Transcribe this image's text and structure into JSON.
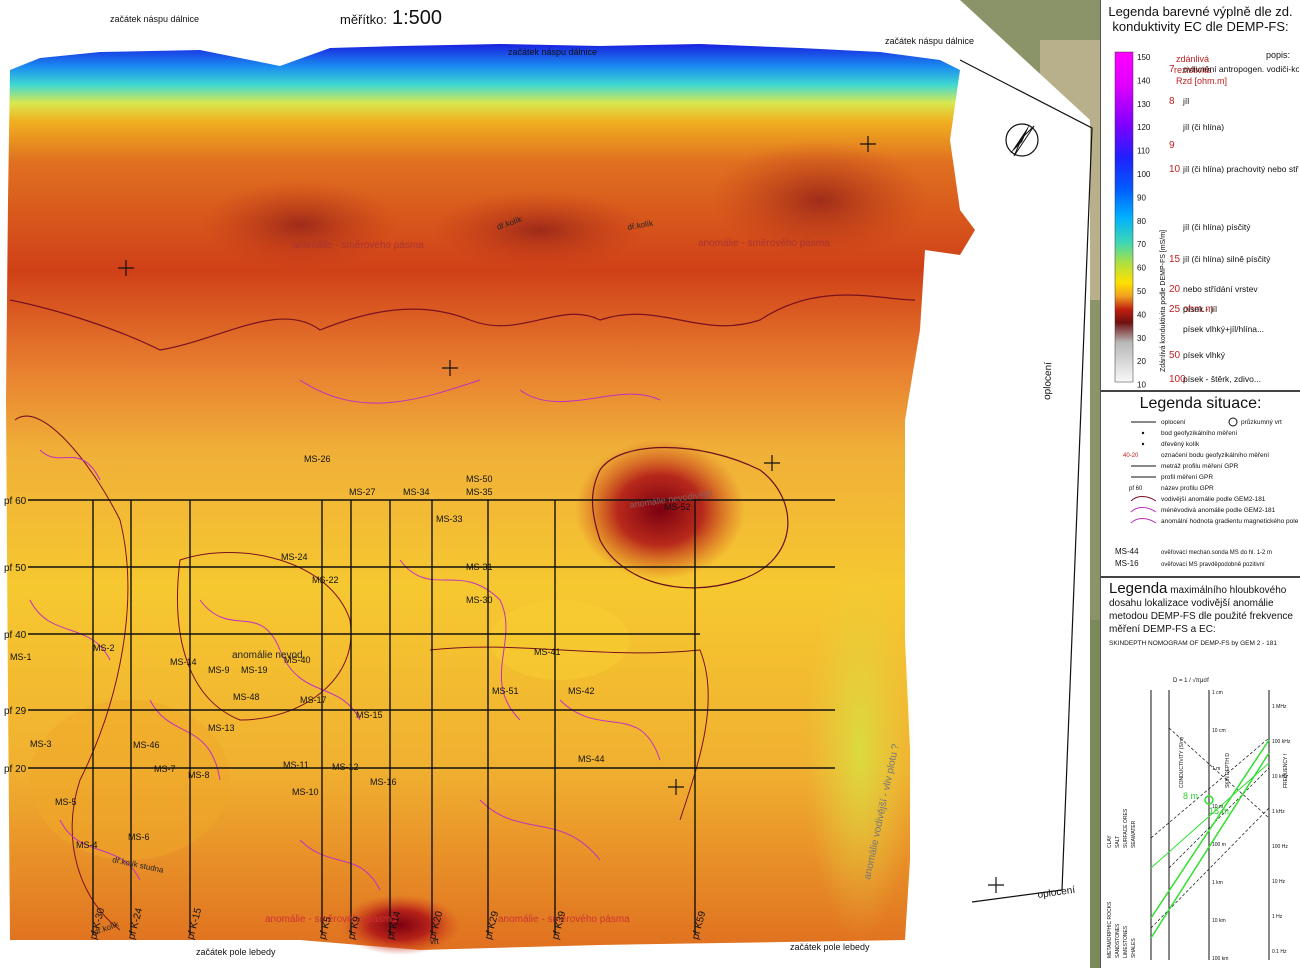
{
  "map": {
    "scale_label": "měřítko:",
    "scale_value": "1:500",
    "top_labels": [
      "začátek náspu dálnice",
      "začátek náspu dálnice",
      "začátek náspu dálnice"
    ],
    "bottom_labels": [
      "začátek pole lebedy",
      "začátek pole lebedy"
    ],
    "fence_labels": [
      "oplocení",
      "oplocení"
    ],
    "anomaly_labels": [
      "anomálie - směrového pásma",
      "anomálie - směrového pásma",
      "anomálie - směrového pásma",
      "anomálie - směrového pásma"
    ],
    "anomaly_center_label": "anomálie nevodivější",
    "anomaly_left_label": "anomálie\nnevod.",
    "side_anomaly_label": "anomálie vodivější - vliv plotu ?",
    "stake_labels": [
      "dř.kolík",
      "dř.kolík",
      "dř.kolík",
      "dř.kolík studna"
    ],
    "drill_label": "vrt",
    "profile_rows": [
      "pf 60",
      "pf 50",
      "pf 40",
      "pf 29",
      "pf 20"
    ],
    "profile_cols": [
      "pf K-30",
      "pf K-24",
      "pf K-15",
      "pf K5",
      "pf K9",
      "pf K14",
      "pf K20",
      "pf K29",
      "pf K39",
      "pf K59"
    ],
    "ms_points": [
      "MS-26",
      "MS-27",
      "MS-34",
      "MS-50",
      "MS-35",
      "MS-33",
      "MS-24",
      "MS-22",
      "MS-31",
      "MS-30",
      "MS-1",
      "MS-2",
      "MS-14",
      "MS-9",
      "MS-19",
      "MS-40",
      "MS-48",
      "MS-17",
      "MS-41",
      "MS-51",
      "MS-42",
      "MS-13",
      "MS-15",
      "MS-3",
      "MS-46",
      "MS-7",
      "MS-8",
      "MS-11",
      "MS-10",
      "MS-12",
      "MS-16",
      "MS-44",
      "MS-5",
      "MS-6",
      "MS-4",
      "MS-52"
    ]
  },
  "legend_ec": {
    "title": "Legenda barevné výplně dle zd. konduktivity EC dle DEMP-FS:",
    "axis_label": "Zdánlivá konduktivita podle DEMP-FS [mS/m]",
    "ticks": [
      "150",
      "140",
      "130",
      "120",
      "110",
      "100",
      "90",
      "80",
      "70",
      "60",
      "50",
      "40",
      "30",
      "20",
      "10"
    ],
    "resistivity_header": "zdánlivá rezistivita Rzd [ohm.m]",
    "notes_header": "popis:",
    "rows": [
      {
        "r": "7",
        "d": "ovlivnění antropogen. vodiči-kovy"
      },
      {
        "r": "8",
        "d": "jíl"
      },
      {
        "r": "",
        "d": "jíl (či hlína)"
      },
      {
        "r": "9",
        "d": ""
      },
      {
        "r": "10",
        "d": "jíl (či hlína) prachovitý nebo střídání vrstev"
      },
      {
        "r": "",
        "d": "jíl (či hlína) písčitý"
      },
      {
        "r": "15",
        "d": "jíl (či hlína) silně písčitý"
      },
      {
        "r": "20",
        "d": "nebo střídání vrstev"
      },
      {
        "r": "25 ohm.m",
        "d": "písek - jíl"
      },
      {
        "r": "",
        "d": "písek vlhký+jíl/hlína..."
      },
      {
        "r": "50",
        "d": "písek vlhký"
      },
      {
        "r": "100",
        "d": "písek - štěrk, zdivo..."
      }
    ],
    "colors": [
      "#ff00ff",
      "#c000ff",
      "#8000ff",
      "#0000ff",
      "#0080ff",
      "#00c0ff",
      "#00e0a0",
      "#a0e000",
      "#ffe000",
      "#ffa000",
      "#e05000",
      "#a01000",
      "#b0b0b0",
      "#d8d8d8",
      "#f4f4f4"
    ]
  },
  "legend_sit": {
    "title": "Legenda situace:",
    "items": [
      "oplocení",
      "průzkumný vrt",
      "bod geofyzikálního měření",
      "dřevěný kolík",
      "40-20",
      "označení bodu geofyzikálního měření",
      "metráž profilu měření GPR",
      "profil měření GPR",
      "pf 60",
      "název profilu GPR",
      "vodivější anomálie podle GEM2-181",
      "méněvodivá anomálie podle GEM2-181",
      "anomální hodnota gradientu magnetického pole",
      "MS-44",
      "ověřovací mechan.sonda MS do hl. 1-2 m",
      "MS-16",
      "ověřovací MS pravděpodobně pozitivní"
    ]
  },
  "legend_depth": {
    "title_big": "Legenda",
    "title_rest": "maximálního hloubkového dosahu lokalizace vodivější anomálie metodou DEMP-FS dle použité frekvence měření DEMP-FS a EC:",
    "nomo_title": "SKINDEPTH NOMOGRAM OF DEMP-FS by GEM 2 - 181",
    "formula": "D = 1 / √πμσf",
    "depth_marks": [
      "8 m",
      "15 m"
    ],
    "axes": [
      "CONDUCTIVITY (S/m)",
      "SKIN DEPTH D",
      "FREQUENCY f"
    ],
    "freq_ticks": [
      "1 MHz",
      "100 kHz",
      "10 kHz",
      "1 kHz",
      "100 Hz",
      "10 Hz",
      "1 Hz",
      "0.1 Hz"
    ],
    "depth_ticks": [
      "1 cm",
      "10 cm",
      "1 m",
      "10 m",
      "100 m",
      "1 km",
      "10 km",
      "100 km"
    ],
    "rock_labels": [
      "METAMORPHIC ROCKS",
      "SANDSTONES",
      "LIMESTONES",
      "SHALES",
      "CLAY",
      "SALT",
      "SURFACE ORES",
      "SEAWATER"
    ]
  }
}
